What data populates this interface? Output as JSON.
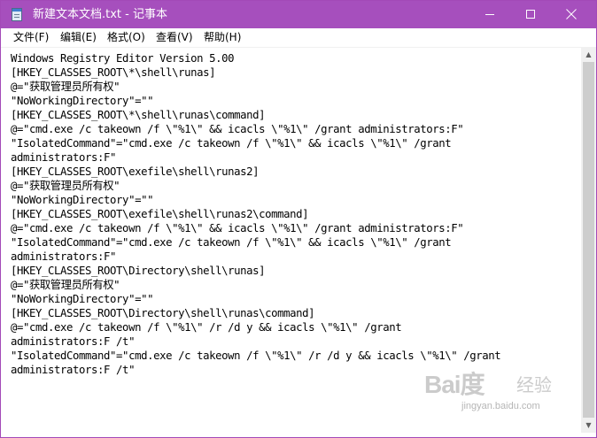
{
  "window": {
    "title": "新建文本文档.txt - 记事本",
    "accent_color": "#a64fbd"
  },
  "menu": {
    "items": [
      {
        "label": "文件(F)"
      },
      {
        "label": "编辑(E)"
      },
      {
        "label": "格式(O)"
      },
      {
        "label": "查看(V)"
      },
      {
        "label": "帮助(H)"
      }
    ]
  },
  "editor": {
    "content": "Windows Registry Editor Version 5.00\n[HKEY_CLASSES_ROOT\\*\\shell\\runas]\n@=\"获取管理员所有权\"\n\"NoWorkingDirectory\"=\"\"\n[HKEY_CLASSES_ROOT\\*\\shell\\runas\\command]\n@=\"cmd.exe /c takeown /f \\\"%1\\\" && icacls \\\"%1\\\" /grant administrators:F\"\n\"IsolatedCommand\"=\"cmd.exe /c takeown /f \\\"%1\\\" && icacls \\\"%1\\\" /grant\nadministrators:F\"\n[HKEY_CLASSES_ROOT\\exefile\\shell\\runas2]\n@=\"获取管理员所有权\"\n\"NoWorkingDirectory\"=\"\"\n[HKEY_CLASSES_ROOT\\exefile\\shell\\runas2\\command]\n@=\"cmd.exe /c takeown /f \\\"%1\\\" && icacls \\\"%1\\\" /grant administrators:F\"\n\"IsolatedCommand\"=\"cmd.exe /c takeown /f \\\"%1\\\" && icacls \\\"%1\\\" /grant\nadministrators:F\"\n[HKEY_CLASSES_ROOT\\Directory\\shell\\runas]\n@=\"获取管理员所有权\"\n\"NoWorkingDirectory\"=\"\"\n[HKEY_CLASSES_ROOT\\Directory\\shell\\runas\\command]\n@=\"cmd.exe /c takeown /f \\\"%1\\\" /r /d y && icacls \\\"%1\\\" /grant\nadministrators:F /t\"\n\"IsolatedCommand\"=\"cmd.exe /c takeown /f \\\"%1\\\" /r /d y && icacls \\\"%1\\\" /grant\nadministrators:F /t\""
  },
  "icons": {
    "app": "notepad-icon",
    "minimize": "minimize-icon",
    "maximize": "maximize-icon",
    "close": "close-icon"
  },
  "watermark": {
    "logo": "Bai度",
    "sub": "经验",
    "url": "jingyan.baidu.com"
  }
}
